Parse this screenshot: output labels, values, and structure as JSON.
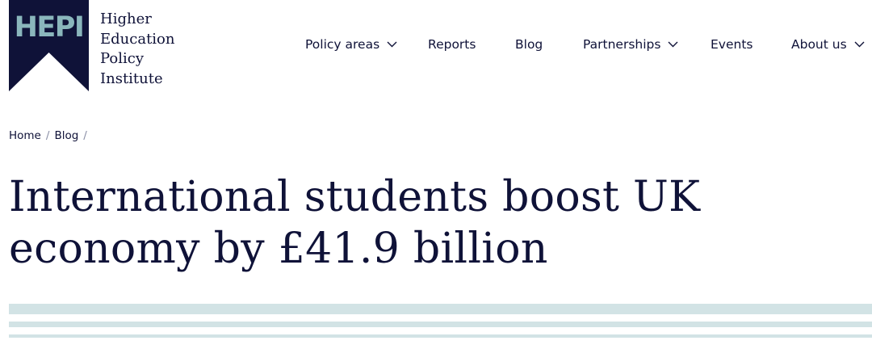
{
  "logo": {
    "mark_text": "HEPI",
    "name_lines": [
      "Higher",
      "Education",
      "Policy",
      "Institute"
    ]
  },
  "nav": {
    "items": [
      {
        "label": "Policy areas",
        "has_dropdown": true
      },
      {
        "label": "Reports",
        "has_dropdown": false
      },
      {
        "label": "Blog",
        "has_dropdown": false
      },
      {
        "label": "Partnerships",
        "has_dropdown": true
      },
      {
        "label": "Events",
        "has_dropdown": false
      },
      {
        "label": "About us",
        "has_dropdown": true
      }
    ]
  },
  "breadcrumb": {
    "items": [
      "Home",
      "Blog"
    ],
    "separator": "/"
  },
  "article": {
    "title": "International students boost UK economy by £41.9 billion"
  },
  "colors": {
    "navy": "#0f1238",
    "logo_text": "#8ab6bc",
    "stripe": "#d2e3e5"
  }
}
